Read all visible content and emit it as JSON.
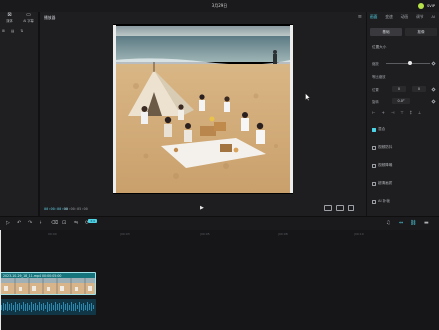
{
  "titlebar": {
    "title": "3月29日",
    "right_label": "SVIP"
  },
  "left_panel": {
    "tabs": [
      {
        "label": "媒体",
        "icon": "media-icon"
      },
      {
        "label": "AI 字幕",
        "icon": "ai-subtitle-icon"
      }
    ],
    "row2": [
      "⊞",
      "▤",
      "⇅"
    ]
  },
  "player": {
    "title": "播放器",
    "timecode_current": "00:00:00:00",
    "timecode_total": "00:00:05:00"
  },
  "right_panel": {
    "tabs": [
      "画面",
      "变速",
      "动画",
      "调节",
      "AI"
    ],
    "active_tab_index": 0,
    "subtabs": [
      "基础",
      "抠像"
    ],
    "active_subtab_index": 0,
    "section_position_size": "位置大小",
    "scale_label": "缩放",
    "scale_value_fraction": 0.55,
    "uniform_scale_label": "等比缩放",
    "position_label": "位置",
    "pos_x": "0",
    "pos_y": "0",
    "rotate_label": "旋转",
    "rotate_value": "0.0°",
    "blend_label": "混合",
    "stabilize_label": "视频防抖",
    "denoise_label": "视频降噪",
    "super_res_label": "超清画质",
    "ai_beauty_label": "AI 补帧"
  },
  "timeline": {
    "badge": "3:4",
    "ruler": [
      "00:00",
      "|00:03",
      "|00:05",
      "|00:08",
      "|00:10"
    ],
    "clip_name": "2023-10-29_18_11.mp4  00:00:05:00"
  },
  "colors": {
    "accent": "#4dd3e6",
    "clip_video": "#16757c",
    "clip_audio": "#113746"
  }
}
